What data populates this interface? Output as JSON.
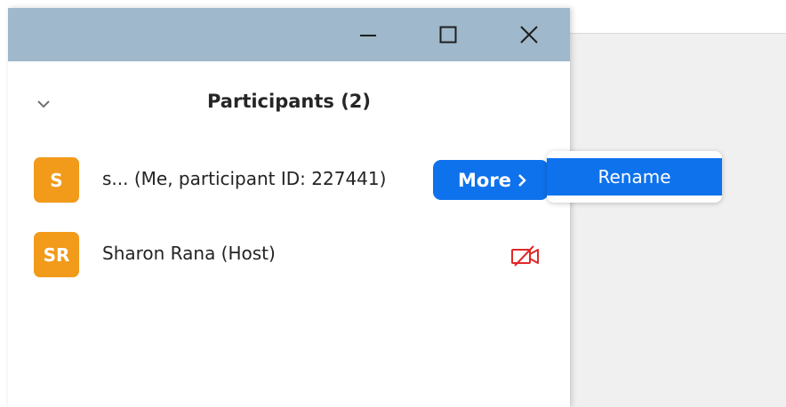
{
  "window": {
    "buttons": {
      "minimize": "minimize-icon",
      "maximize": "maximize-icon",
      "close": "close-icon"
    }
  },
  "panel": {
    "title": "Participants (2)",
    "collapse_icon": "chevron-down-icon"
  },
  "participants": [
    {
      "initials": "S",
      "name": "s... (Me, participant ID: 227441)",
      "avatar_color": "#f29a1a"
    },
    {
      "initials": "SR",
      "name": "Sharon Rana (Host)",
      "avatar_color": "#f29a1a",
      "status_icon": "video-off-icon"
    }
  ],
  "more_button": {
    "label": "More",
    "icon": "chevron-right-icon"
  },
  "context_menu": {
    "items": [
      {
        "label": "Rename"
      }
    ]
  },
  "colors": {
    "titlebar": "#9fb8cb",
    "accent": "#0e72ed",
    "avatar": "#f29a1a",
    "video_off": "#e02828"
  }
}
